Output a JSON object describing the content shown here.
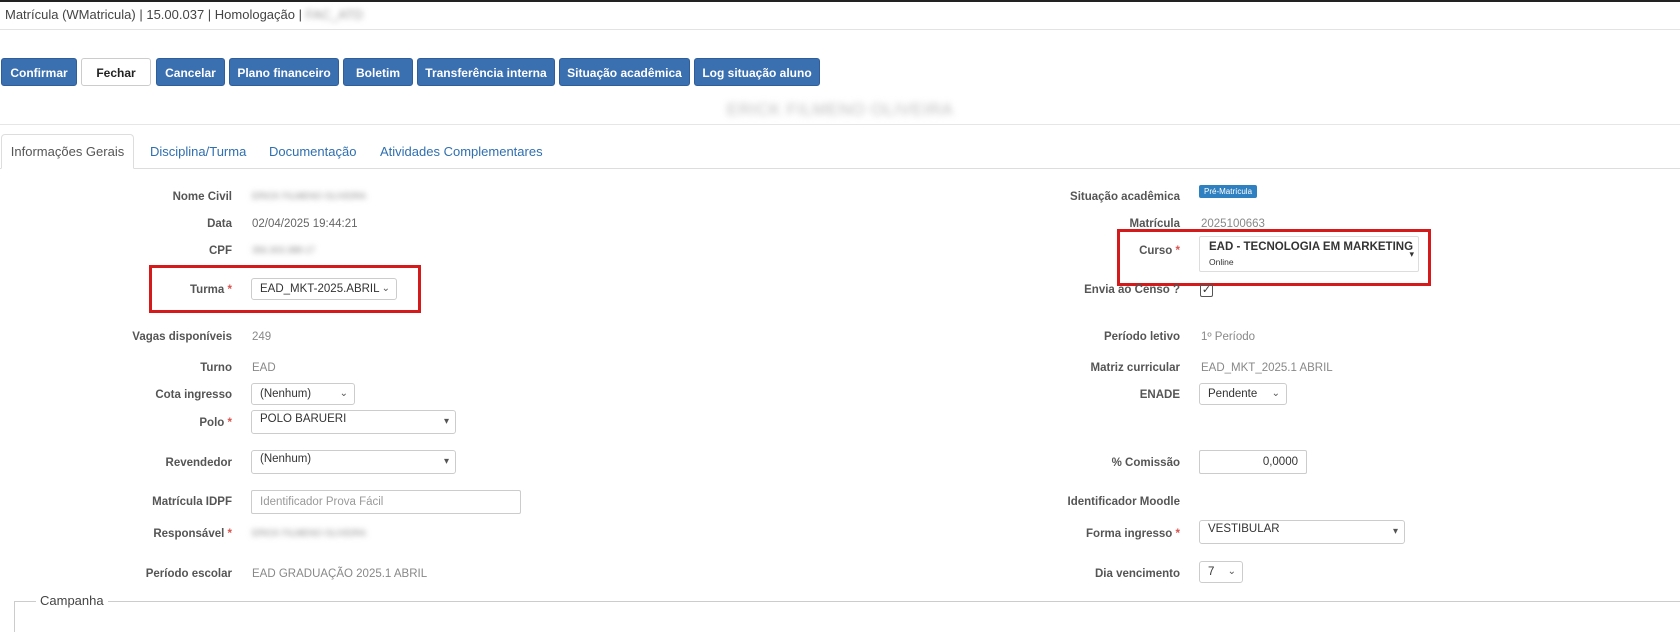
{
  "window": {
    "title": "Matrícula (WMatricula) | 15.00.037 | Homologação | ",
    "title_blurred": "FAC_ATD"
  },
  "toolbar": {
    "confirmar": "Confirmar",
    "fechar": "Fechar",
    "cancelar": "Cancelar",
    "plano_financeiro": "Plano financeiro",
    "boletim": "Boletim",
    "transferencia_interna": "Transferência interna",
    "situacao_academica": "Situação acadêmica",
    "log_situacao_aluno": "Log situação aluno"
  },
  "student_name": "ERICK FILMENO OLIVEIRA",
  "tabs": {
    "informacoes_gerais": "Informações Gerais",
    "disciplina_turma": "Disciplina/Turma",
    "documentacao": "Documentação",
    "atividades_complementares": "Atividades Complementares"
  },
  "left": {
    "nome_civil_label": "Nome Civil",
    "nome_civil_value": "ERICK FILMENO OLIVEIRA",
    "data_label": "Data",
    "data_value": "02/04/2025 19:44:21",
    "cpf_label": "CPF",
    "cpf_value": "356.303.388-17",
    "turma_label": "Turma",
    "turma_value": "EAD_MKT-2025.ABRIL",
    "vagas_label": "Vagas disponíveis",
    "vagas_value": "249",
    "turno_label": "Turno",
    "turno_value": "EAD",
    "cota_label": "Cota ingresso",
    "cota_value": "(Nenhum)",
    "polo_label": "Polo",
    "polo_value": "POLO BARUERI",
    "revendedor_label": "Revendedor",
    "revendedor_value": "(Nenhum)",
    "matricula_idpf_label": "Matrícula IDPF",
    "matricula_idpf_placeholder": "Identificador Prova Fácil",
    "responsavel_label": "Responsável",
    "responsavel_value": "ERICK FILMENO OLIVEIRA",
    "periodo_escolar_label": "Período escolar",
    "periodo_escolar_value": "EAD GRADUAÇÃO 2025.1 ABRIL"
  },
  "right": {
    "situacao_label": "Situação acadêmica",
    "situacao_badge": "Pré-Matrícula",
    "matricula_label": "Matrícula",
    "matricula_value": "2025100663",
    "curso_label": "Curso",
    "curso_value": "EAD - TECNOLOGIA EM MARKETING",
    "curso_sub": "Online",
    "censo_label": "Envia ao Censo ?",
    "periodo_letivo_label": "Período letivo",
    "periodo_letivo_value": "1º Período",
    "matriz_label": "Matriz curricular",
    "matriz_value": "EAD_MKT_2025.1 ABRIL",
    "enade_label": "ENADE",
    "enade_value": "Pendente",
    "comissao_label": "% Comissão",
    "comissao_value": "0,0000",
    "moodle_label": "Identificador Moodle",
    "forma_ingresso_label": "Forma ingresso",
    "forma_ingresso_value": "VESTIBULAR",
    "dia_vencimento_label": "Dia vencimento",
    "dia_vencimento_value": "7"
  },
  "campanha": {
    "legend": "Campanha"
  },
  "required_mark": "*",
  "colors": {
    "primary_button": "#3a6fb0",
    "highlight_box": "#d41a1a",
    "badge": "#2f80c0",
    "required": "#d9534f"
  }
}
